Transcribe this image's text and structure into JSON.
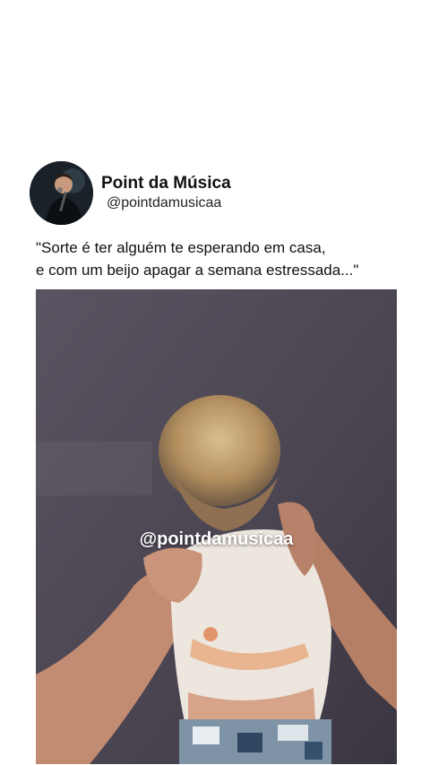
{
  "post": {
    "author_name": "Point da Música",
    "author_handle": "@pointdamusicaa",
    "quote_line_1": "\"Sorte é ter alguém te esperando em casa,",
    "quote_line_2": "e com um beijo apagar a semana estressada...\"",
    "media": {
      "watermark": "@pointdamusicaa"
    }
  },
  "colors": {
    "background": "#ffffff",
    "text": "#111111",
    "video_wall": "#4c4652"
  }
}
